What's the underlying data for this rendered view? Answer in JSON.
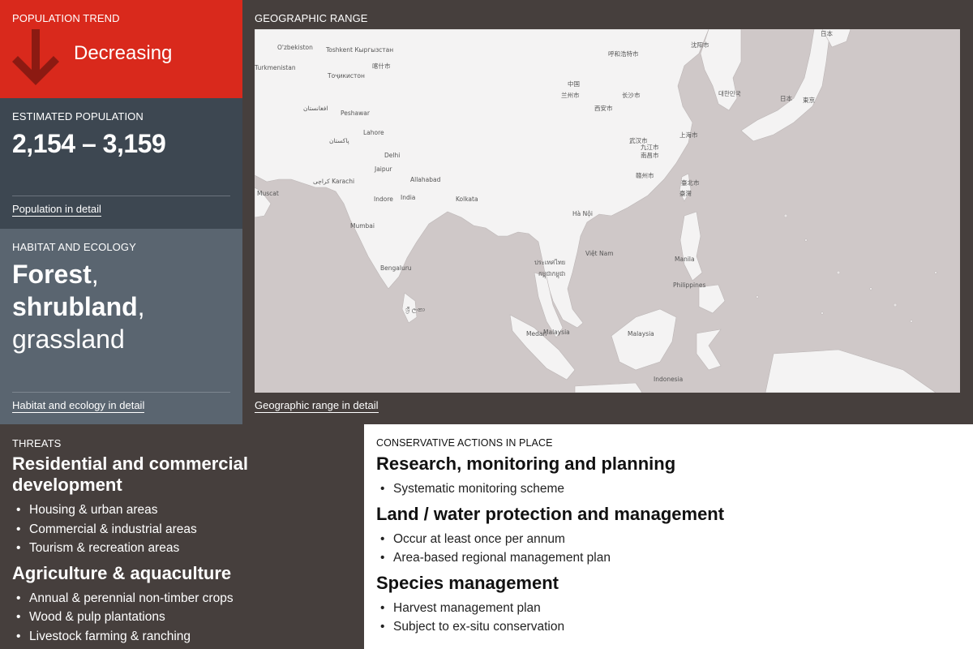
{
  "population_trend": {
    "label": "POPULATION TREND",
    "value": "Decreasing",
    "trend_icon": "arrow-down-icon",
    "color": "#d9291c"
  },
  "estimated_population": {
    "label": "ESTIMATED POPULATION",
    "value": "2,154 – 3,159",
    "link": "Population in detail"
  },
  "habitat": {
    "label": "HABITAT AND ECOLOGY",
    "items": [
      "Forest",
      "shrubland",
      "grassland"
    ],
    "link": "Habitat and ecology in detail"
  },
  "geographic_range": {
    "label": "GEOGRAPHIC RANGE",
    "link": "Geographic range in detail",
    "map_labels": {
      "uzbekistan": "O'zbekiston",
      "toshkent": "Toshkent Кыргызстан",
      "turkmenistan": "Turkmenistan",
      "tojikiston": "Тоҷикистон",
      "afghanistan": "افغانستان",
      "peshawar": "Peshawar",
      "lahore": "Lahore",
      "pakistan": "پاکستان",
      "karachi": "کراچی Karachi",
      "delhi": "Delhi",
      "jaipur": "Jaipur",
      "allahabad": "Allahabad",
      "india": "India",
      "indore": "Indore",
      "kolkata": "Kolkata",
      "mumbai": "Mumbai",
      "bengaluru": "Bengaluru",
      "muscat": "Muscat",
      "sri_lanka": "ශ්‍රී ලංකා",
      "china": "中国",
      "lanzhou": "兰州市",
      "xian": "西安市",
      "changsha": "长沙市",
      "wuhan": "武汉市",
      "jiujiang": "九江市",
      "nanchang": "南昌市",
      "ganzhou": "赣州市",
      "shanghai": "上海市",
      "taipei": "臺北市",
      "taiwan": "臺灣",
      "hohhot": "呼和浩特市",
      "shenyang": "沈阳市",
      "japan": "日本",
      "tokyo": "東京",
      "hanoi": "Hà Nội",
      "thailand": "ประเทศไทย",
      "cambodia": "កម្ពុជាកម្ពុជា",
      "vietnam": "Việt Nam",
      "manila": "Manila",
      "philippines": "Philippines",
      "malaysia_w": "Malaysia",
      "malaysia_e": "Malaysia",
      "medan": "Medan",
      "indonesia": "Indonesia",
      "korea": "대한민국",
      "kashgar": "喀什市"
    }
  },
  "threats": {
    "label": "THREATS",
    "categories": [
      {
        "title": "Residential and commercial development",
        "items": [
          "Housing & urban areas",
          "Commercial & industrial areas",
          "Tourism & recreation areas"
        ]
      },
      {
        "title": "Agriculture & aquaculture",
        "items": [
          "Annual & perennial non-timber crops",
          "Wood & pulp plantations",
          "Livestock farming & ranching"
        ]
      }
    ]
  },
  "conservation": {
    "label": "CONSERVATIVE ACTIONS IN PLACE",
    "categories": [
      {
        "title": "Research, monitoring and planning",
        "items": [
          "Systematic monitoring scheme"
        ]
      },
      {
        "title": "Land / water protection and management",
        "items": [
          "Occur at least once per annum",
          "Area-based regional management plan"
        ]
      },
      {
        "title": "Species management",
        "items": [
          "Harvest management plan",
          "Subject to ex-situ conservation"
        ]
      }
    ]
  }
}
